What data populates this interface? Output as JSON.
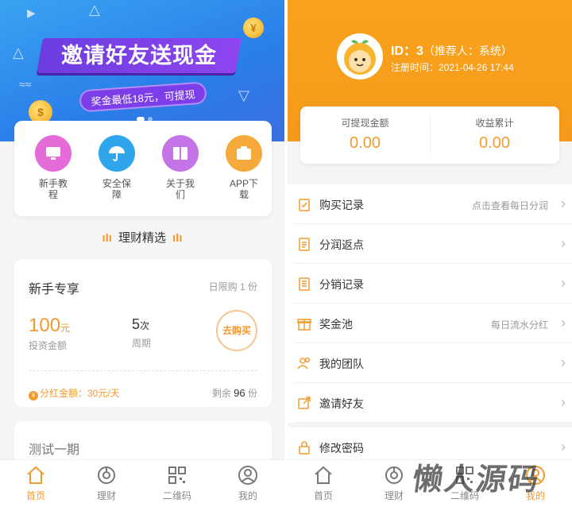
{
  "left": {
    "banner": {
      "title": "邀请好友送现金",
      "subtitle": "奖金最低18元，可提现"
    },
    "quick_links": [
      {
        "label": "新手教程",
        "icon": "monitor-icon",
        "color": "#e56bd8"
      },
      {
        "label": "安全保障",
        "icon": "umbrella-icon",
        "color": "#2fa6ec"
      },
      {
        "label": "关于我们",
        "icon": "book-icon",
        "color": "#c574e8"
      },
      {
        "label": "APP下载",
        "icon": "box-icon",
        "color": "#f5a93a"
      }
    ],
    "section_title": "理财精选",
    "product": {
      "name": "新手专享",
      "limit": "日限购 1 份",
      "amount": "100",
      "amount_unit": "元",
      "amount_label": "投资金额",
      "period": "5",
      "period_unit": "次",
      "period_label": "周期",
      "buy_label": "去购买",
      "dividend": "分红金额：30元/天",
      "remaining_prefix": "剩余",
      "remaining_count": "96",
      "remaining_suffix": "份"
    },
    "product2": {
      "name": "测试一期"
    },
    "tabs": [
      {
        "label": "首页",
        "icon": "home-icon"
      },
      {
        "label": "理财",
        "icon": "finance-icon"
      },
      {
        "label": "二维码",
        "icon": "qrcode-icon"
      },
      {
        "label": "我的",
        "icon": "user-icon"
      }
    ]
  },
  "right": {
    "profile": {
      "id_label": "ID：",
      "id": "3",
      "referrer": "（推荐人：系统）",
      "registered": "注册时间：2021-04-26 17:44"
    },
    "stats": [
      {
        "label": "可提现金额",
        "value": "0.00"
      },
      {
        "label": "收益累计",
        "value": "0.00"
      }
    ],
    "menu": [
      {
        "label": "购买记录",
        "hint": "点击查看每日分润",
        "icon": "clipboard-icon"
      },
      {
        "label": "分润返点",
        "hint": "",
        "icon": "list-icon"
      },
      {
        "label": "分销记录",
        "hint": "",
        "icon": "document-icon"
      },
      {
        "label": "奖金池",
        "hint": "每日流水分红",
        "icon": "gift-icon"
      },
      {
        "label": "我的团队",
        "hint": "",
        "icon": "team-icon"
      },
      {
        "label": "邀请好友",
        "hint": "",
        "icon": "share-icon"
      }
    ],
    "menu2": [
      {
        "label": "修改密码",
        "hint": "",
        "icon": "lock-icon"
      }
    ],
    "tabs": [
      {
        "label": "首页",
        "icon": "home-icon"
      },
      {
        "label": "理财",
        "icon": "finance-icon"
      },
      {
        "label": "二维码",
        "icon": "qrcode-icon"
      },
      {
        "label": "我的",
        "icon": "user-icon"
      }
    ]
  },
  "watermark": "懒人源码",
  "colors": {
    "accent": "#f29a2e",
    "banner_blue": "#2a7ee8",
    "header_orange": "#f9a21e"
  }
}
